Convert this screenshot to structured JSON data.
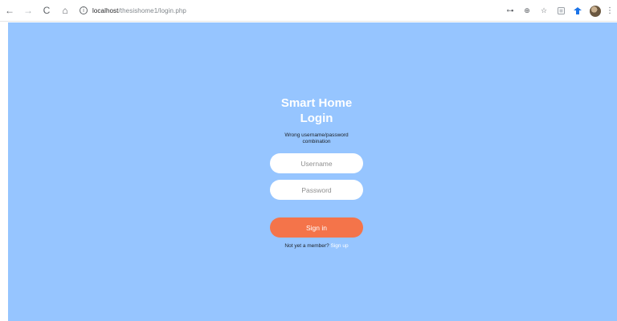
{
  "browser": {
    "back_icon": "←",
    "forward_icon": "→",
    "reload_icon": "C",
    "home_icon": "⌂",
    "url_host": "localhost",
    "url_path": "/thesishome1/login.php",
    "key_icon": "⊶",
    "zoom_icon": "⊕",
    "star_icon": "☆",
    "menu_icon": "⋮"
  },
  "login": {
    "title": "Smart Home Login",
    "error": "Wrong username/password combination",
    "username_placeholder": "Username",
    "password_placeholder": "Password",
    "signin_label": "Sign in",
    "member_prompt": "Not yet a member?",
    "signup_link": "Sign up"
  },
  "colors": {
    "page_background": "#96c5ff",
    "signin_button": "#f4744a",
    "input_background": "#ffffff"
  }
}
